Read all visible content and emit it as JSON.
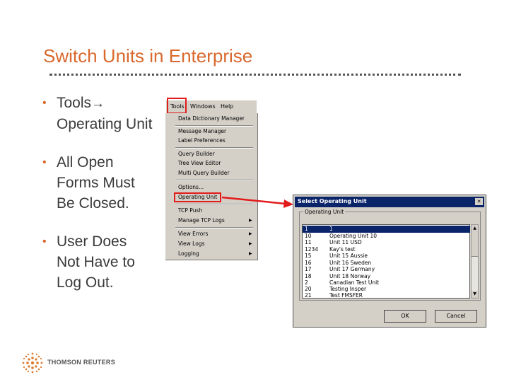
{
  "slide": {
    "title": "Switch Units in Enterprise",
    "bullets": [
      {
        "line1": "Tools",
        "line2": "Operating Unit"
      },
      {
        "line1": "All Open",
        "line2": "Forms Must",
        "line3": "Be Closed."
      },
      {
        "line1": "User Does",
        "line2": "Not Have to",
        "line3": "Log Out."
      }
    ]
  },
  "menubar": {
    "tools": "Tools",
    "windows": "Windows",
    "help": "Help"
  },
  "tools_menu": {
    "items": [
      "Data Dictionary Manager",
      "Message Manager",
      "Label Preferences",
      "Query Builder",
      "Tree View Editor",
      "Multi Query Builder",
      "Options...",
      "Operating Unit",
      "TCP Push",
      "Manage TCP Logs",
      "View Errors",
      "View Logs",
      "Logging"
    ]
  },
  "dialog": {
    "title": "Select Operating Unit",
    "group_label": "Operating Unit",
    "rows": [
      {
        "code": "1",
        "name": "1"
      },
      {
        "code": "10",
        "name": "Operating Unit 10"
      },
      {
        "code": "11",
        "name": "Unit 11 USD"
      },
      {
        "code": "1234",
        "name": "Kay's test"
      },
      {
        "code": "15",
        "name": "Unit 15 Aussie"
      },
      {
        "code": "16",
        "name": "Unit 16 Sweden"
      },
      {
        "code": "17",
        "name": "Unit 17 Germany"
      },
      {
        "code": "18",
        "name": "Unit 18 Norway"
      },
      {
        "code": "2",
        "name": "Canadian Test Unit"
      },
      {
        "code": "20",
        "name": "Testing Insper"
      },
      {
        "code": "21",
        "name": "Test FMSFER"
      }
    ],
    "ok_label": "OK",
    "cancel_label": "Cancel"
  },
  "logo": {
    "text": "THOMSON REUTERS"
  },
  "colors": {
    "accent": "#d9682c",
    "highlight": "#e21b1b",
    "selection": "#0a246a"
  }
}
